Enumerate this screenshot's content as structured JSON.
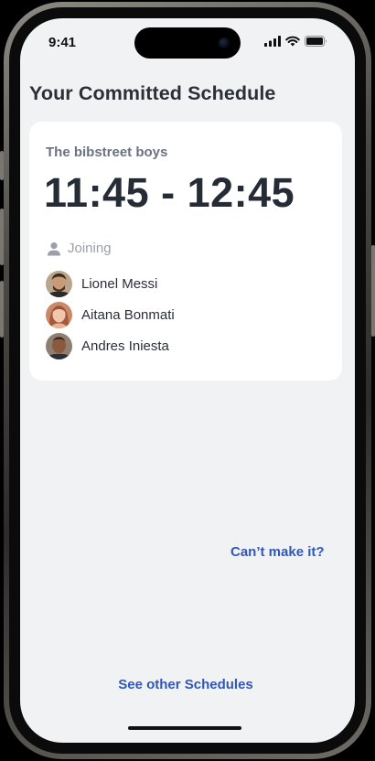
{
  "status_bar": {
    "time": "9:41",
    "icons": [
      "cellular-signal-icon",
      "wifi-icon",
      "battery-icon"
    ]
  },
  "page": {
    "title": "Your Committed Schedule"
  },
  "schedule_card": {
    "group_name": "The bibstreet boys",
    "time_range": "11:45 - 12:45",
    "joining_label": "Joining",
    "joining_icon": "person-icon",
    "participants": [
      {
        "name": "Lionel Messi",
        "avatar": "avatar-photo"
      },
      {
        "name": "Aitana Bonmati",
        "avatar": "avatar-photo"
      },
      {
        "name": "Andres Iniesta",
        "avatar": "avatar-photo"
      }
    ]
  },
  "actions": {
    "cant_make_it": "Can’t make it?",
    "see_other_schedules": "See other Schedules"
  },
  "colors": {
    "background": "#f1f2f4",
    "card": "#ffffff",
    "title_text": "#2b2f36",
    "muted_text": "#6b7280",
    "link": "#2f58b8"
  }
}
